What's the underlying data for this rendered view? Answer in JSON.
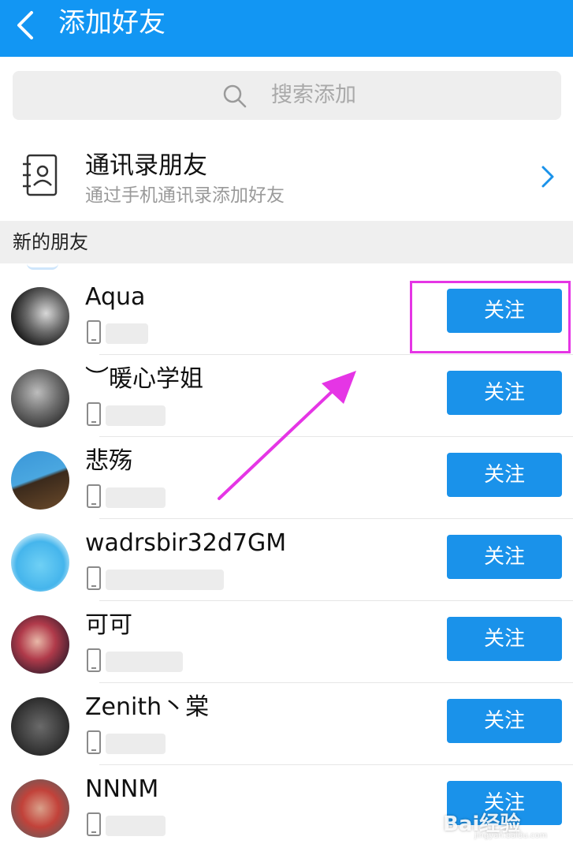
{
  "header": {
    "title": "添加好友",
    "back_icon": "chevron-left-icon"
  },
  "search": {
    "placeholder": "搜索添加",
    "icon": "search-icon"
  },
  "contacts": {
    "title": "通讯录朋友",
    "subtitle": "通过手机通讯录添加好友",
    "icon": "address-book-icon",
    "chevron": "chevron-right-icon"
  },
  "section": {
    "label": "新的朋友"
  },
  "friends": [
    {
      "name": "Aqua",
      "button": "关注"
    },
    {
      "name": "︶暖心学姐",
      "button": "关注"
    },
    {
      "name": "悲殇",
      "button": "关注"
    },
    {
      "name": "wadrsbir32d7GM",
      "button": "关注"
    },
    {
      "name": "可可",
      "button": "关注"
    },
    {
      "name": "Zenith丶棠",
      "button": "关注"
    },
    {
      "name": "NNNM",
      "button": "关注"
    }
  ],
  "watermark": {
    "text": "Bai经验",
    "sub": "jingyan.baidu.com"
  },
  "colors": {
    "header": "#1296f3",
    "button": "#1a92ea",
    "annotation": "#e535e5"
  }
}
